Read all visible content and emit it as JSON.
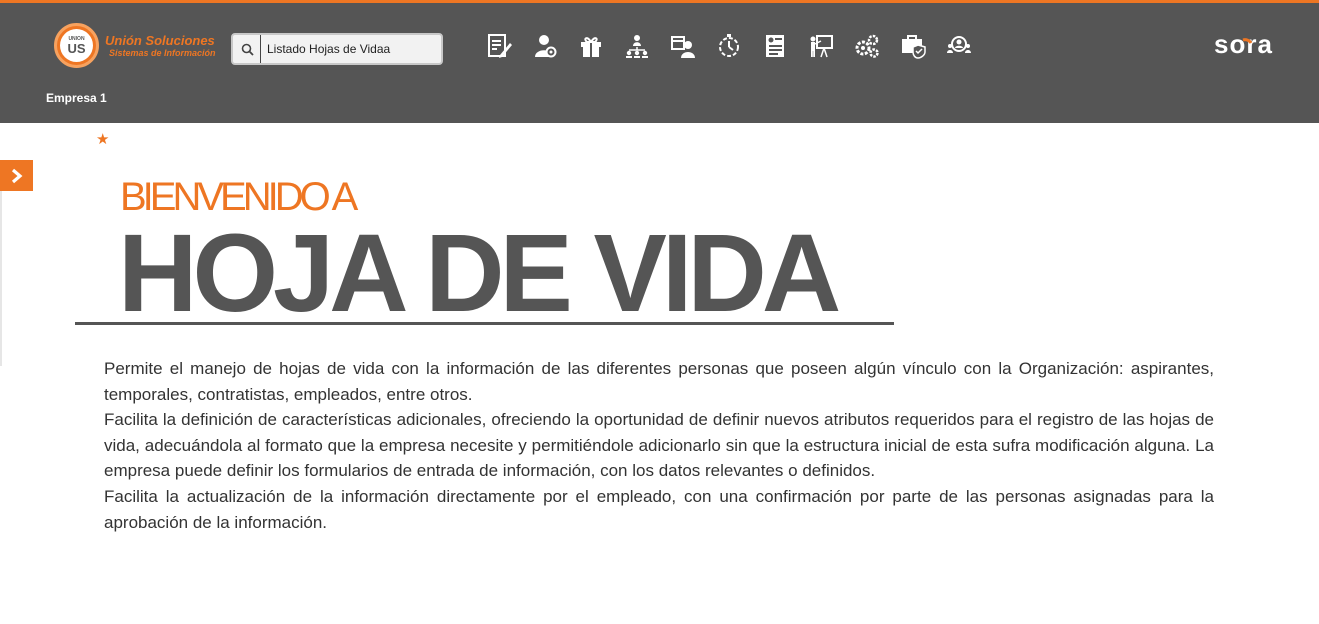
{
  "header": {
    "logo_small_text": "UNION",
    "logo_big_text": "US",
    "brand_name": "Unión Soluciones",
    "brand_tagline": "Sistemas de Información",
    "company": "Empresa 1",
    "product_logo": "sora"
  },
  "search": {
    "value": "Listado Hojas de Vidaa",
    "icon": "search-icon"
  },
  "modules": [
    {
      "name": "module-edit-document",
      "icon": "document-edit-icon"
    },
    {
      "name": "module-person-settings",
      "icon": "person-gear-icon"
    },
    {
      "name": "module-gift",
      "icon": "gift-icon"
    },
    {
      "name": "module-organization",
      "icon": "org-chart-icon"
    },
    {
      "name": "module-schedule",
      "icon": "calendar-person-icon"
    },
    {
      "name": "module-timer",
      "icon": "stopwatch-icon"
    },
    {
      "name": "module-resume",
      "icon": "resume-icon"
    },
    {
      "name": "module-training",
      "icon": "presentation-icon"
    },
    {
      "name": "module-settings",
      "icon": "gears-icon"
    },
    {
      "name": "module-safety",
      "icon": "briefcase-shield-icon"
    },
    {
      "name": "module-search-people",
      "icon": "people-search-icon"
    }
  ],
  "main": {
    "welcome": "BIENVENIDO A",
    "title": "HOJA DE VIDA",
    "paragraphs": [
      "Permite el manejo de hojas de vida con la información de las diferentes personas que poseen algún vínculo con la Organización: aspirantes, temporales, contratistas, empleados, entre otros.",
      "Facilita la definición de características adicionales, ofreciendo la oportunidad de definir nuevos atributos requeridos para el registro de las hojas de vida, adecuándola al formato que la empresa necesite y permitiéndole adicionarlo sin que la estructura inicial de esta sufra modificación alguna. La empresa puede definir los formularios de entrada de información, con los datos relevantes o definidos.",
      "Facilita la actualización de la información directamente por el empleado, con una confirmación por parte de las personas asignadas para la aprobación de la información."
    ]
  },
  "colors": {
    "accent": "#ee7623",
    "header_bg": "#555555",
    "title_text": "#555555",
    "body_text": "#333333"
  }
}
